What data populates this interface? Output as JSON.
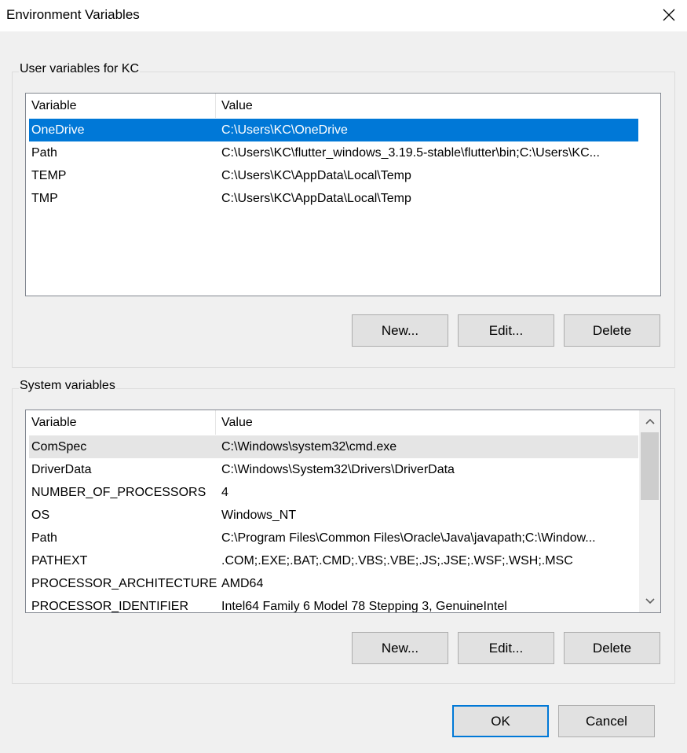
{
  "window": {
    "title": "Environment Variables"
  },
  "user_group": {
    "label": "User variables for KC",
    "columns": [
      "Variable",
      "Value"
    ],
    "rows": [
      {
        "variable": "OneDrive",
        "value": "C:\\Users\\KC\\OneDrive"
      },
      {
        "variable": "Path",
        "value": "C:\\Users\\KC\\flutter_windows_3.19.5-stable\\flutter\\bin;C:\\Users\\KC..."
      },
      {
        "variable": "TEMP",
        "value": "C:\\Users\\KC\\AppData\\Local\\Temp"
      },
      {
        "variable": "TMP",
        "value": "C:\\Users\\KC\\AppData\\Local\\Temp"
      }
    ],
    "buttons": {
      "new": "New...",
      "edit": "Edit...",
      "delete": "Delete"
    }
  },
  "system_group": {
    "label": "System variables",
    "columns": [
      "Variable",
      "Value"
    ],
    "rows": [
      {
        "variable": "ComSpec",
        "value": "C:\\Windows\\system32\\cmd.exe"
      },
      {
        "variable": "DriverData",
        "value": "C:\\Windows\\System32\\Drivers\\DriverData"
      },
      {
        "variable": "NUMBER_OF_PROCESSORS",
        "value": "4"
      },
      {
        "variable": "OS",
        "value": "Windows_NT"
      },
      {
        "variable": "Path",
        "value": "C:\\Program Files\\Common Files\\Oracle\\Java\\javapath;C:\\Window..."
      },
      {
        "variable": "PATHEXT",
        "value": ".COM;.EXE;.BAT;.CMD;.VBS;.VBE;.JS;.JSE;.WSF;.WSH;.MSC"
      },
      {
        "variable": "PROCESSOR_ARCHITECTURE",
        "value": "AMD64"
      },
      {
        "variable": "PROCESSOR_IDENTIFIER",
        "value": "Intel64 Family 6 Model 78 Stepping 3, GenuineIntel"
      }
    ],
    "buttons": {
      "new": "New...",
      "edit": "Edit...",
      "delete": "Delete"
    }
  },
  "footer": {
    "ok": "OK",
    "cancel": "Cancel"
  },
  "colors": {
    "selection": "#0078d7",
    "hover_row": "#e5e5e5",
    "dialog_bg": "#f0f0f0"
  },
  "icons": {
    "close": "close-icon",
    "scroll_up": "chevron-up-icon",
    "scroll_down": "chevron-down-icon"
  }
}
